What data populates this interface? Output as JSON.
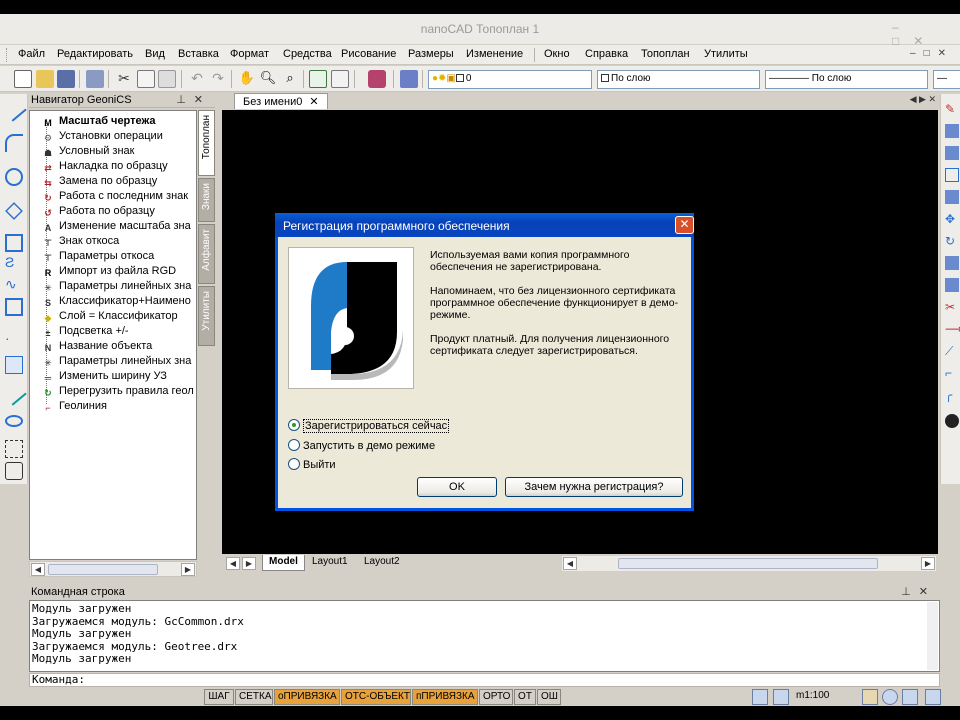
{
  "window": {
    "title": "nanoCAD Топоплан 1"
  },
  "menu": [
    "Файл",
    "Редактировать",
    "Вид",
    "Вставка",
    "Формат",
    "Средства",
    "Рисование",
    "Размеры",
    "Изменение",
    "Окно",
    "Справка",
    "Топоплан",
    "Утилиты"
  ],
  "toolbar": {
    "layer_value": "0",
    "linetype_value": "По слою",
    "lineweight_value": "По слою"
  },
  "navigator": {
    "title": "Навигатор GeoniCS",
    "tabs": [
      "Топоплан",
      "Знаки",
      "Алфавит",
      "Утилиты"
    ],
    "items": [
      {
        "label": "Масштаб чертежа",
        "icon": "M"
      },
      {
        "label": "Установки операции",
        "icon": "⚙"
      },
      {
        "label": "Условный знак",
        "icon": "☗"
      },
      {
        "label": "Накладка по образцу",
        "icon": "⇄"
      },
      {
        "label": "Замена по образцу",
        "icon": "⇆"
      },
      {
        "label": "Работа с последним знак",
        "icon": "↻"
      },
      {
        "label": "Работа по образцу",
        "icon": "↺"
      },
      {
        "label": "Изменение масштаба зна",
        "icon": "A"
      },
      {
        "label": "Знак откоса",
        "icon": "⊤"
      },
      {
        "label": "Параметры откоса",
        "icon": "⊤"
      },
      {
        "label": "Импорт из файла RGD",
        "icon": "R"
      },
      {
        "label": "Параметры линейных зна",
        "icon": "✳"
      },
      {
        "label": "Классификатор+Наимено",
        "icon": "S"
      },
      {
        "label": "Слой = Классификатор",
        "icon": "◆"
      },
      {
        "label": "Подсветка +/-",
        "icon": "±"
      },
      {
        "label": "Название объекта",
        "icon": "N"
      },
      {
        "label": "Параметры линейных зна",
        "icon": "✳"
      },
      {
        "label": "Изменить ширину УЗ",
        "icon": "═"
      },
      {
        "label": "Перегрузить правила геол",
        "icon": "↻"
      },
      {
        "label": "Геолиния",
        "icon": "⌐"
      }
    ]
  },
  "document": {
    "tab": "Без имени0",
    "layouts": [
      "Model",
      "Layout1",
      "Layout2"
    ]
  },
  "command": {
    "title": "Командная строка",
    "log": [
      "Модуль загружен",
      "Загружаемся модуль: GcCommon.drx",
      "Модуль загружен",
      "Загружаемся модуль: Geotree.drx",
      "Модуль загружен"
    ],
    "prompt": "Команда:"
  },
  "statusbar": {
    "toggles": [
      {
        "label": "ШАГ",
        "on": false
      },
      {
        "label": "СЕТКА",
        "on": false
      },
      {
        "label": "оПРИВЯЗКА",
        "on": true
      },
      {
        "label": "ОТС-ОБЪЕКТ",
        "on": true
      },
      {
        "label": "пПРИВЯЗКА",
        "on": true
      },
      {
        "label": "ОРТО",
        "on": false
      },
      {
        "label": "ОТ",
        "on": false
      },
      {
        "label": "ОШ",
        "on": false
      }
    ],
    "scale": "m1:100"
  },
  "dialog": {
    "title": "Регистрация программного обеспечения",
    "paragraphs": [
      "Используемая вами копия программного обеспечения не зарегистрирована.",
      "Напоминаем, что без лицензионного сертификата программное обеспечение функционирует в демо-режиме.",
      "Продукт платный. Для получения лицензионного сертификата следует зарегистрироваться."
    ],
    "options": [
      "Зарегистрироваться сейчас",
      "Запустить в демо режиме",
      "Выйти"
    ],
    "selected_option": 0,
    "ok_label": "OK",
    "why_label": "Зачем нужна регистрация?"
  },
  "colors": {
    "accent_blue": "#0054e3",
    "status_on": "#e8a23c",
    "logo_blue": "#1f7ac8"
  }
}
